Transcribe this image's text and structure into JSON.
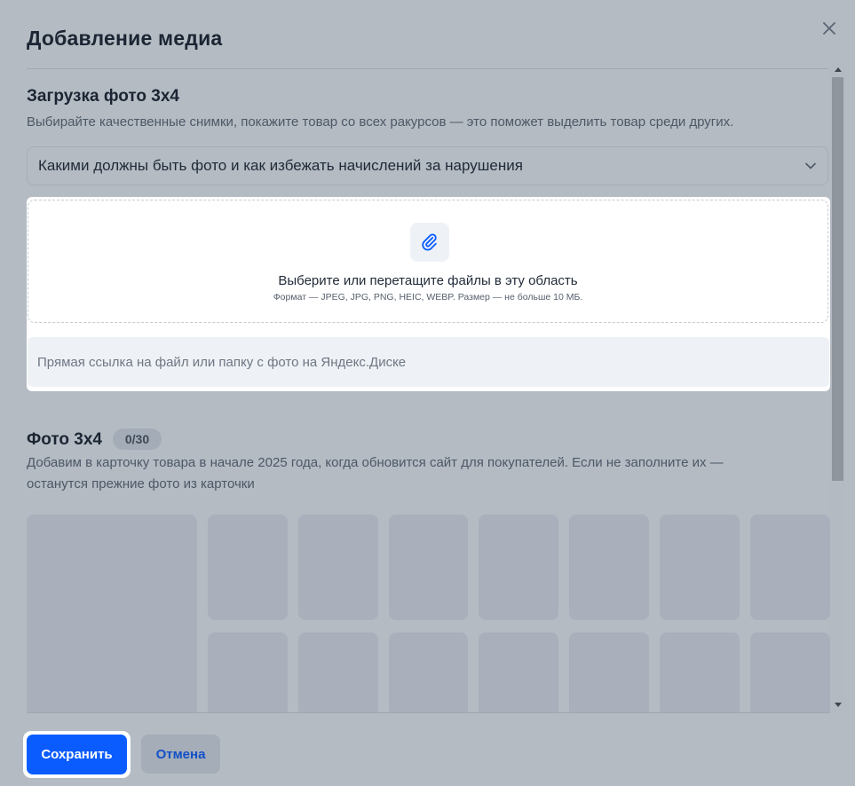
{
  "modal": {
    "title": "Добавление медиа",
    "close_icon": "close-icon"
  },
  "upload_section": {
    "title": "Загрузка фото 3х4",
    "description": "Выбирайте качественные снимки, покажите товар со всех ракурсов — это поможет выделить товар среди других.",
    "accordion_label": "Какими должны быть фото и как избежать начислений за нарушения",
    "accordion_icon": "chevron-down-icon",
    "dropzone_icon": "paperclip-icon",
    "dropzone_text": "Выберите или перетащите файлы в эту область",
    "dropzone_hint": "Формат — JPEG, JPG, PNG, HEIC, WEBP. Размер — не больше 10 МБ.",
    "link_placeholder": "Прямая ссылка на файл или папку с фото на Яндекс.Диске"
  },
  "photos_section": {
    "title": "Фото 3х4",
    "count_badge": "0/30",
    "description_line1": "Добавим в карточку товара в начале 2025 года, когда обновится сайт для покупателей. Если не заполните их —",
    "description_line2": "останутся прежние фото из карточки"
  },
  "footer": {
    "save_label": "Сохранить",
    "cancel_label": "Отмена"
  },
  "colors": {
    "accent": "#0b5cff",
    "overlay": "#b4bbc3",
    "slot": "#a9b0bb"
  }
}
